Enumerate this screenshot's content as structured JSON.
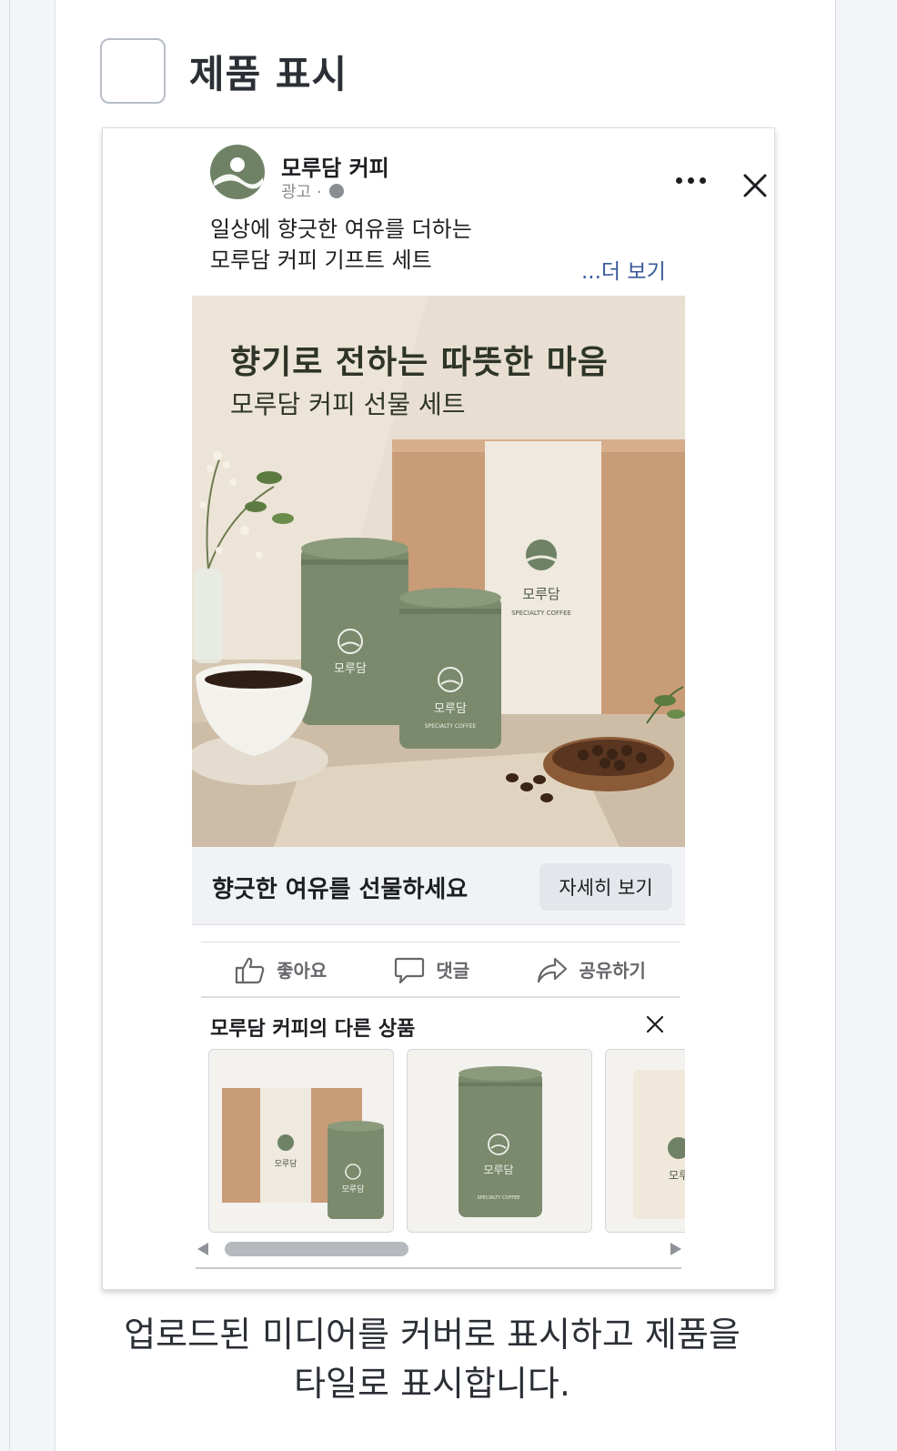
{
  "option": {
    "label": "제품 표시",
    "checked": false
  },
  "ad": {
    "brand_name": "모루담 커피",
    "sponsored_label": "광고 ·",
    "primary_text_line1": "일상에 향긋한 여유를 더하는",
    "primary_text_line2": "모루담 커피 기프트 세트",
    "see_more": "...더 보기",
    "media": {
      "headline": "향기로 전하는 따뜻한 마음",
      "subhead": "모루담 커피 선물 세트",
      "box_brand": "모루담",
      "box_tagline": "SPECIALTY COFFEE",
      "can_brand": "모루담",
      "can_tagline": "SPECIALTY COFFEE"
    },
    "cta_headline": "향긋한 여유를 선물하세요",
    "cta_button": "자세히 보기",
    "actions": {
      "like": "좋아요",
      "comment": "댓글",
      "share": "공유하기"
    },
    "carousel": {
      "title": "모루담 커피의 다른 상품",
      "tiles": [
        {
          "brand": "모루담",
          "sub_brand": "모루담"
        },
        {
          "brand": "모루담",
          "tagline": "SPECIALTY COFFEE"
        },
        {
          "brand": "모루"
        }
      ]
    }
  },
  "description_line1": "업로드된 미디어를 커버로 표시하고 제품을",
  "description_line2": "타일로 표시합니다.",
  "colors": {
    "brand_green": "#6f8265",
    "kraft": "#c99c78",
    "link_blue": "#385898"
  }
}
